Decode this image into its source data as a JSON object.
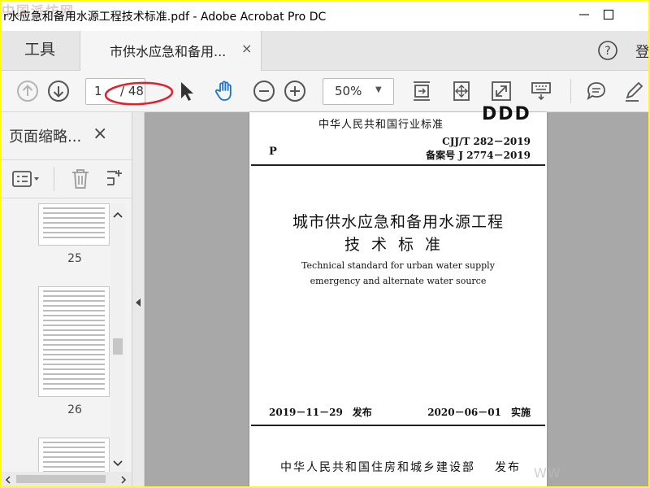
{
  "window": {
    "title": "r水应急和备用水源工程技术标准.pdf - Adobe Acrobat Pro DC",
    "watermark_top": "中国派坊网"
  },
  "tabs": {
    "tools_label": "工具",
    "doc_label": "市供水应急和备用...",
    "doc_close": "×",
    "login_label": "登"
  },
  "toolbar": {
    "page_current": "1",
    "page_total": "/ 48",
    "zoom": "50%",
    "zoom_caret": "▼",
    "highlight_color": "#e0202a"
  },
  "sidepanel": {
    "title": "页面缩略...",
    "close": "×",
    "thumbnails": [
      {
        "label": "25"
      },
      {
        "label": "26"
      }
    ]
  },
  "document": {
    "logo": "DDD",
    "ministry": "中华人民共和国行业标准",
    "category_letter": "P",
    "code": "CJJ/T 282－2019",
    "filing_number": "备案号 J 2774－2019",
    "title_cn_line1": "城市供水应急和备用水源工程",
    "title_cn_line2": "技术标准",
    "title_en_line1": "Technical standard for urban water supply",
    "title_en_line2": "emergency and alternate water source",
    "issue_date": "2019－11－29　发布",
    "effective_date": "2020－06－01　实施",
    "publisher": "中华人民共和国住房和城乡建设部",
    "publisher_action": "发布"
  },
  "watermark_bottom": "WW"
}
